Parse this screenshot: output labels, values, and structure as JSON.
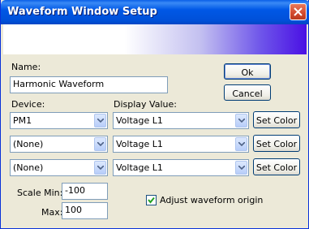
{
  "window": {
    "title": "Waveform Window Setup"
  },
  "name": {
    "label": "Name:",
    "value": "Harmonic Waveform"
  },
  "buttons": {
    "ok": "Ok",
    "cancel": "Cancel"
  },
  "device": {
    "label": "Device:"
  },
  "display_value": {
    "label": "Display Value:"
  },
  "rows": [
    {
      "device": "PM1",
      "display": "Voltage L1",
      "set_color": "Set Color"
    },
    {
      "device": "(None)",
      "display": "Voltage L1",
      "set_color": "Set Color"
    },
    {
      "device": "(None)",
      "display": "Voltage L1",
      "set_color": "Set Color"
    }
  ],
  "scale": {
    "min_label": "Scale Min:",
    "min_value": "-100",
    "max_label": "Max:",
    "max_value": "100"
  },
  "adjust_origin": {
    "label": "Adjust waveform origin",
    "checked": true
  }
}
